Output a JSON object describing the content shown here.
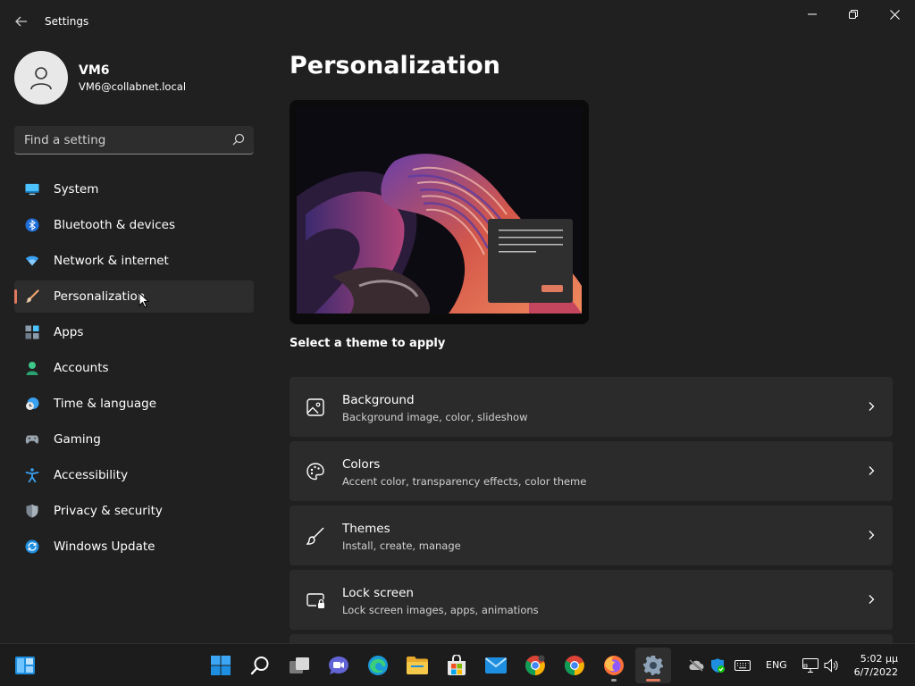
{
  "window": {
    "title": "Settings"
  },
  "profile": {
    "name": "VM6",
    "email": "VM6@collabnet.local"
  },
  "search": {
    "placeholder": "Find a setting"
  },
  "nav": {
    "items": [
      {
        "label": "System",
        "icon": "monitor-icon"
      },
      {
        "label": "Bluetooth & devices",
        "icon": "bluetooth-icon"
      },
      {
        "label": "Network & internet",
        "icon": "wifi-icon"
      },
      {
        "label": "Personalization",
        "icon": "brush-icon",
        "selected": true
      },
      {
        "label": "Apps",
        "icon": "apps-icon"
      },
      {
        "label": "Accounts",
        "icon": "person-icon"
      },
      {
        "label": "Time & language",
        "icon": "clock-globe-icon"
      },
      {
        "label": "Gaming",
        "icon": "gamepad-icon"
      },
      {
        "label": "Accessibility",
        "icon": "accessibility-icon"
      },
      {
        "label": "Privacy & security",
        "icon": "shield-icon"
      },
      {
        "label": "Windows Update",
        "icon": "update-icon"
      }
    ]
  },
  "main": {
    "title": "Personalization",
    "theme_prompt": "Select a theme to apply",
    "cards": [
      {
        "title": "Background",
        "subtitle": "Background image, color, slideshow",
        "icon": "image-icon"
      },
      {
        "title": "Colors",
        "subtitle": "Accent color, transparency effects, color theme",
        "icon": "palette-icon"
      },
      {
        "title": "Themes",
        "subtitle": "Install, create, manage",
        "icon": "brush-icon"
      },
      {
        "title": "Lock screen",
        "subtitle": "Lock screen images, apps, animations",
        "icon": "lock-screen-icon"
      }
    ]
  },
  "taskbar": {
    "apps": [
      "start-icon",
      "search-icon",
      "task-view-icon",
      "teams-chat-icon",
      "edge-icon",
      "file-explorer-icon",
      "store-icon",
      "mail-icon",
      "chrome-icon",
      "chrome-icon",
      "firefox-icon",
      "settings-icon"
    ],
    "language": "ENG",
    "time": "5:02 μμ",
    "date": "6/7/2022"
  },
  "colors": {
    "accent": "#e07a5f",
    "background": "#202020",
    "card": "#2b2b2b"
  }
}
